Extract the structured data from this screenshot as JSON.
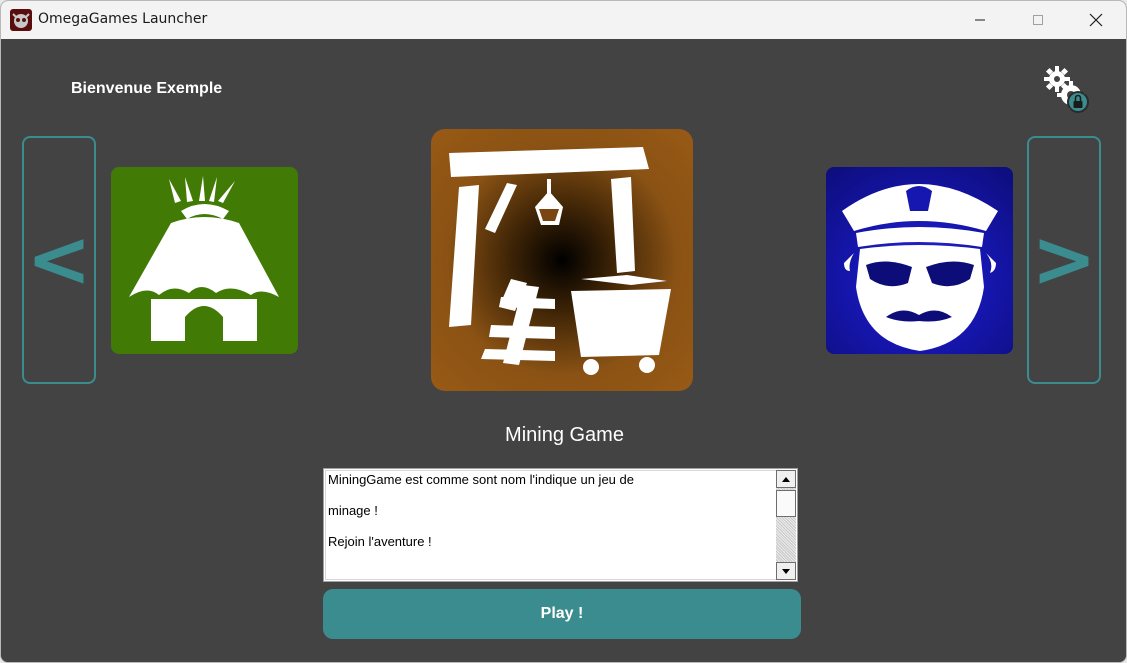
{
  "window": {
    "title": "OmegaGames Launcher",
    "icon": "omegagames-logo-icon"
  },
  "header": {
    "welcome": "Bienvenue Exemple",
    "settings_icon": "gears-lock-icon"
  },
  "carousel": {
    "prev_label": "<",
    "next_label": ">",
    "games": [
      {
        "icon": "hut-icon",
        "color": "#417b06",
        "position": "previous"
      },
      {
        "icon": "mine-cart-icon",
        "color": "#995a15",
        "position": "selected"
      },
      {
        "icon": "police-officer-icon",
        "color": "#1616b0",
        "position": "next"
      }
    ]
  },
  "selected_game": {
    "title": "Mining Game",
    "description": [
      "MiningGame est comme sont nom l'indique un jeu de",
      "minage !",
      "Rejoin l'aventure !"
    ]
  },
  "actions": {
    "play_label": "Play !"
  },
  "colors": {
    "accent": "#3b8c8e",
    "background": "#434343"
  }
}
